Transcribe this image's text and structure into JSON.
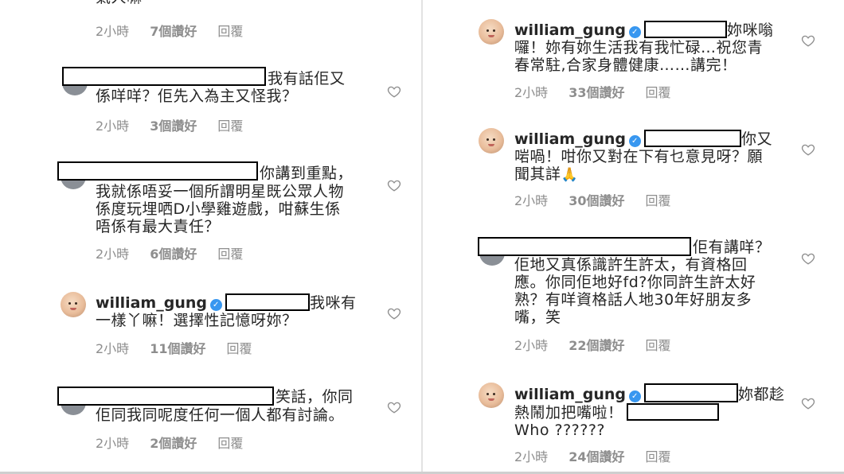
{
  "left": {
    "partial_top": {
      "text": "氣人嘛",
      "time": "2小時",
      "likes": "7個讚好",
      "reply": "回覆"
    },
    "comments": [
      {
        "lines": [
          "我有話佢又",
          "係咩咩？佢先入為主又怪我？"
        ],
        "time": "2小時",
        "likes": "3個讚好",
        "reply": "回覆"
      },
      {
        "lines": [
          "你講到重點，",
          "我就係唔妥一個所謂明星既公眾人物",
          "係度玩埋哂D小學雞遊戲，咁蘇生係",
          "唔係有最大責任？"
        ],
        "time": "2小時",
        "likes": "6個讚好",
        "reply": "回覆"
      },
      {
        "username": "william_gung",
        "lines": [
          "我咪有",
          "一樣丫嘛！選擇性記憶呀妳？"
        ],
        "time": "2小時",
        "likes": "11個讚好",
        "reply": "回覆"
      },
      {
        "lines": [
          "笑話，你同",
          "佢同我同呢度任何一個人都有討論。"
        ],
        "time": "2小時",
        "likes": "2個讚好",
        "reply": "回覆"
      }
    ]
  },
  "right": {
    "comments": [
      {
        "username": "william_gung",
        "lines": [
          "妳咪嗡",
          "囉！妳有妳生活我有我忙碌…祝您青",
          "春常駐,合家身體健康……講完！"
        ],
        "time": "2小時",
        "likes": "33個讚好",
        "reply": "回覆"
      },
      {
        "username": "william_gung",
        "lines": [
          "你又",
          "啱喎！咁你又對在下有乜意見呀？願",
          "聞其詳"
        ],
        "emoji": "🙏",
        "time": "2小時",
        "likes": "30個讚好",
        "reply": "回覆"
      },
      {
        "lines": [
          "佢有講咩？",
          "佢地又真係識許生許太，有資格回",
          "應。你同佢地好fd?你同許生許太好",
          "熟？有咩資格話人地30年好朋友多",
          "嘴，笑"
        ],
        "time": "2小時",
        "likes": "22個讚好",
        "reply": "回覆"
      },
      {
        "username": "william_gung",
        "lines": [
          "妳都趁",
          "熱鬧加把嘴啦！",
          "Who ??????"
        ],
        "time": "2小時",
        "likes": "24個讚好",
        "reply": "回覆"
      }
    ]
  },
  "icons": {
    "verified": "verified-badge-icon",
    "heart": "heart-outline-icon",
    "avatar": "avatar-baby-icon"
  },
  "colors": {
    "text": "#262626",
    "meta": "#8e8e8e",
    "verified": "#3897f0"
  }
}
